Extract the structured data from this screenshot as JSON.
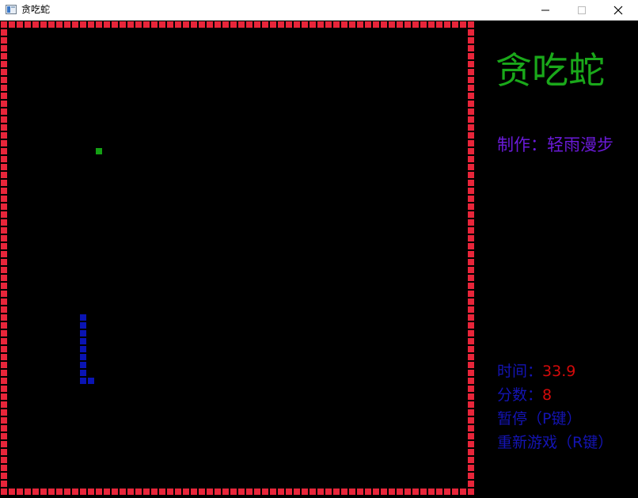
{
  "window": {
    "title": "贪吃蛇",
    "minimize_icon": "minimize-icon",
    "maximize_icon": "maximize-icon",
    "close_icon": "close-icon"
  },
  "game": {
    "grid": {
      "cols": 60,
      "rows": 60
    },
    "food": [
      12,
      16
    ],
    "snake": [
      [
        10,
        37
      ],
      [
        10,
        38
      ],
      [
        10,
        39
      ],
      [
        10,
        40
      ],
      [
        10,
        41
      ],
      [
        10,
        42
      ],
      [
        10,
        43
      ],
      [
        10,
        44
      ],
      [
        10,
        45
      ],
      [
        11,
        45
      ]
    ],
    "colors": {
      "wall": "#e8253a",
      "snake": "#0a14b4",
      "food": "#14a014",
      "background": "#000000"
    }
  },
  "sidebar": {
    "title": "贪吃蛇",
    "author": "制作：轻雨漫步",
    "time_label": "时间：",
    "time_value": "33.9",
    "score_label": "分数：",
    "score_value": "8",
    "pause": "暂停（P键）",
    "restart": "重新游戏（R键）",
    "colors": {
      "title": "#1aa81a",
      "author": "#6a1ad8",
      "label": "#1414b4",
      "value": "#d40a0a"
    }
  }
}
